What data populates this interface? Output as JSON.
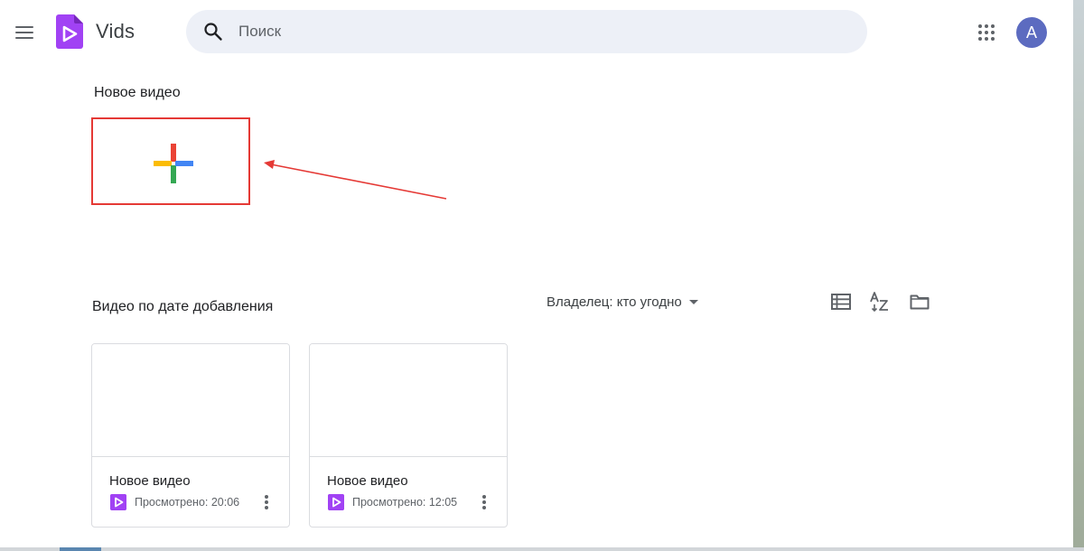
{
  "header": {
    "app_name": "Vids",
    "search_placeholder": "Поиск",
    "avatar_initial": "A"
  },
  "new_video": {
    "label": "Новое видео"
  },
  "list": {
    "title": "Видео по дате добавления",
    "owner_filter": "Владелец: кто угодно"
  },
  "videos": [
    {
      "title": "Новое видео",
      "meta": "Просмотрено: 20:06"
    },
    {
      "title": "Новое видео",
      "meta": "Просмотрено: 12:05"
    }
  ],
  "colors": {
    "brand_purple": "#a142f4",
    "annotation_red": "#e53935",
    "avatar_bg": "#5c6bc0"
  },
  "icons": [
    "menu-icon",
    "vids-logo-icon",
    "search-icon",
    "apps-grid-icon",
    "list-view-icon",
    "sort-az-icon",
    "folder-icon",
    "more-vert-icon"
  ]
}
